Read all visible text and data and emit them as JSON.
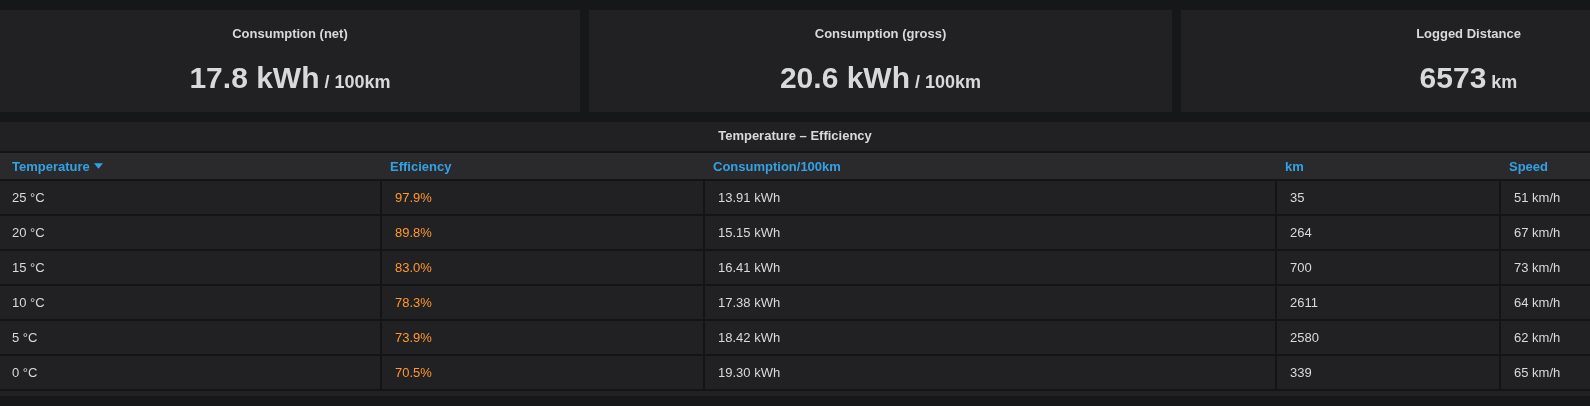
{
  "stats": [
    {
      "title": "Consumption (net)",
      "value": "17.8 kWh",
      "unit": "/ 100km"
    },
    {
      "title": "Consumption (gross)",
      "value": "20.6 kWh",
      "unit": "/ 100km"
    },
    {
      "title": "Logged Distance",
      "value": "6573",
      "unit": "km"
    }
  ],
  "table": {
    "title": "Temperature – Efficiency",
    "columns": [
      {
        "label": "Temperature",
        "sorted": true
      },
      {
        "label": "Efficiency",
        "sorted": false,
        "color": "#ff9830"
      },
      {
        "label": "Consumption/100km",
        "sorted": false
      },
      {
        "label": "km",
        "sorted": false
      },
      {
        "label": "Speed",
        "sorted": false
      }
    ],
    "rows": [
      [
        "25 °C",
        "97.9%",
        "13.91 kWh",
        "35",
        "51 km/h"
      ],
      [
        "20 °C",
        "89.8%",
        "15.15 kWh",
        "264",
        "67 km/h"
      ],
      [
        "15 °C",
        "83.0%",
        "16.41 kWh",
        "700",
        "73 km/h"
      ],
      [
        "10 °C",
        "78.3%",
        "17.38 kWh",
        "2611",
        "64 km/h"
      ],
      [
        "5 °C",
        "73.9%",
        "18.42 kWh",
        "2580",
        "62 km/h"
      ],
      [
        "0 °C",
        "70.5%",
        "19.30 kWh",
        "339",
        "65 km/h"
      ]
    ]
  }
}
